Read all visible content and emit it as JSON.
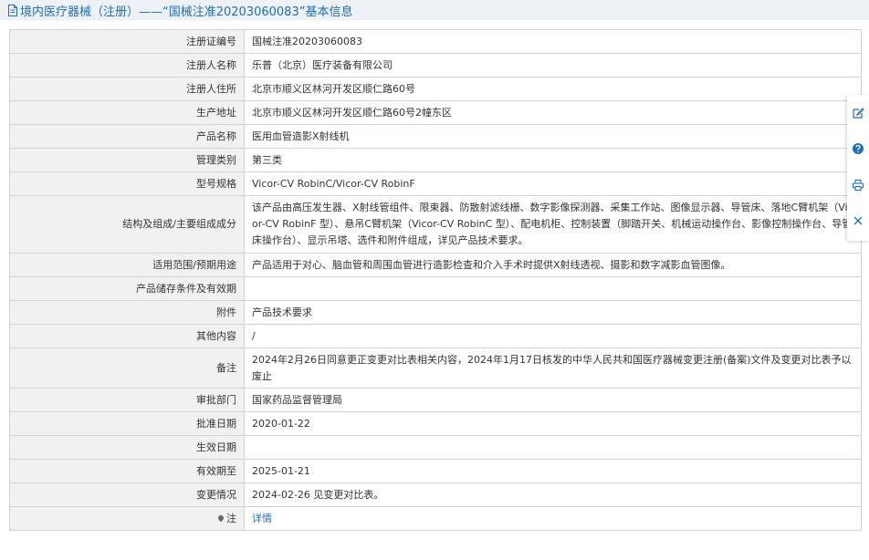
{
  "header": {
    "title": "境内医疗器械（注册）——“国械注准20203060083”基本信息"
  },
  "rows": [
    {
      "label": "注册证编号",
      "value": "国械注准20203060083"
    },
    {
      "label": "注册人名称",
      "value": "乐普（北京）医疗装备有限公司"
    },
    {
      "label": "注册人住所",
      "value": "北京市顺义区林河开发区顺仁路60号"
    },
    {
      "label": "生产地址",
      "value": "北京市顺义区林河开发区顺仁路60号2幢东区"
    },
    {
      "label": "产品名称",
      "value": "医用血管造影X射线机"
    },
    {
      "label": "管理类别",
      "value": "第三类"
    },
    {
      "label": "型号规格",
      "value": "Vicor-CV RobinC/Vicor-CV RobinF"
    },
    {
      "label": "结构及组成/主要组成成分",
      "value": "该产品由高压发生器、X射线管组件、限束器、防散射滤线栅、数字影像探测器、采集工作站、图像显示器、导管床、落地C臂机架（Vicor-CV RobinF 型）、悬吊C臂机架（Vicor-CV RobinC 型）、配电机柜、控制装置（脚踏开关、机械运动操作台、影像控制操作台、导管床操作台）、显示吊塔、选件和附件组成，详见产品技术要求。"
    },
    {
      "label": "适用范围/预期用途",
      "value": "产品适用于对心、脑血管和周围血管进行造影检查和介入手术时提供X射线透视、摄影和数字减影血管图像。"
    },
    {
      "label": "产品储存条件及有效期",
      "value": ""
    },
    {
      "label": "附件",
      "value": "产品技术要求"
    },
    {
      "label": "其他内容",
      "value": "/"
    },
    {
      "label": "备注",
      "value": "2024年2月26日同意更正变更对比表相关内容，2024年1月17日核发的中华人民共和国医疗器械变更注册(备案)文件及变更对比表予以废止"
    },
    {
      "label": "审批部门",
      "value": "国家药品监督管理局"
    },
    {
      "label": "批准日期",
      "value": "2020-01-22"
    },
    {
      "label": "生效日期",
      "value": ""
    },
    {
      "label": "有效期至",
      "value": "2025-01-21"
    },
    {
      "label": "变更情况",
      "value": "2024-02-26 见变更对比表。"
    },
    {
      "label": "注",
      "value": "详情"
    }
  ],
  "side_tools": [
    {
      "icon": "edit-icon"
    },
    {
      "icon": "help-icon"
    },
    {
      "icon": "print-icon"
    },
    {
      "icon": "close-icon"
    }
  ],
  "colors": {
    "accent": "#1d6fb8",
    "label_bg": "#f1f1f1",
    "border": "#d2d2d2",
    "header_bg": "#eef1f6"
  }
}
